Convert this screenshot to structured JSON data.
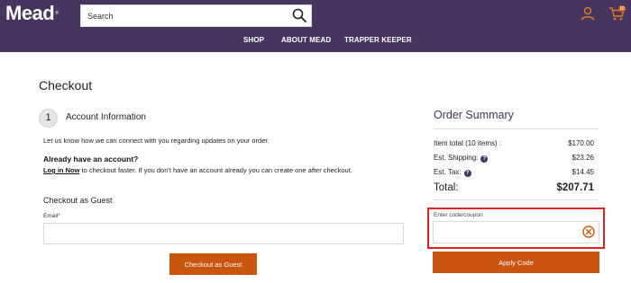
{
  "header": {
    "logo_text": "Mead",
    "logo_mark": "®",
    "search_placeholder": "Search",
    "nav": [
      {
        "label": "SHOP"
      },
      {
        "label": "ABOUT MEAD"
      },
      {
        "label": "TRAPPER KEEPER"
      }
    ],
    "cart_count": "10"
  },
  "checkout": {
    "title": "Checkout",
    "step_number": "1",
    "step_title": "Account Information",
    "info_text": "Let us know how we can connect with you regarding updates on your order.",
    "account_question": "Already have an account?",
    "login_link": "Log in Now",
    "login_text": " to checkout faster. If you don't have an account already you can create one after checkout.",
    "guest_heading": "Checkout as Guest",
    "email_label": "Email",
    "email_required": "*",
    "email_value": "",
    "guest_button": "Checkout as Guest"
  },
  "summary": {
    "title": "Order Summary",
    "item_total_label": "Item total (10 items) :",
    "item_total_value": "$170.00",
    "shipping_label": "Est. Shipping:",
    "shipping_value": "$23.26",
    "tax_label": "Est. Tax:",
    "tax_value": "$14.45",
    "total_label": "Total:",
    "total_value": "$207.71",
    "coupon_label": "Enter code/coupon",
    "coupon_value": "",
    "apply_button": "Apply Code"
  },
  "colors": {
    "header_bg": "#45355f",
    "accent_orange": "#c9550f",
    "highlight_red": "#e02020"
  },
  "icons": [
    "search-icon",
    "user-icon",
    "cart-icon",
    "help-icon",
    "clear-icon"
  ]
}
